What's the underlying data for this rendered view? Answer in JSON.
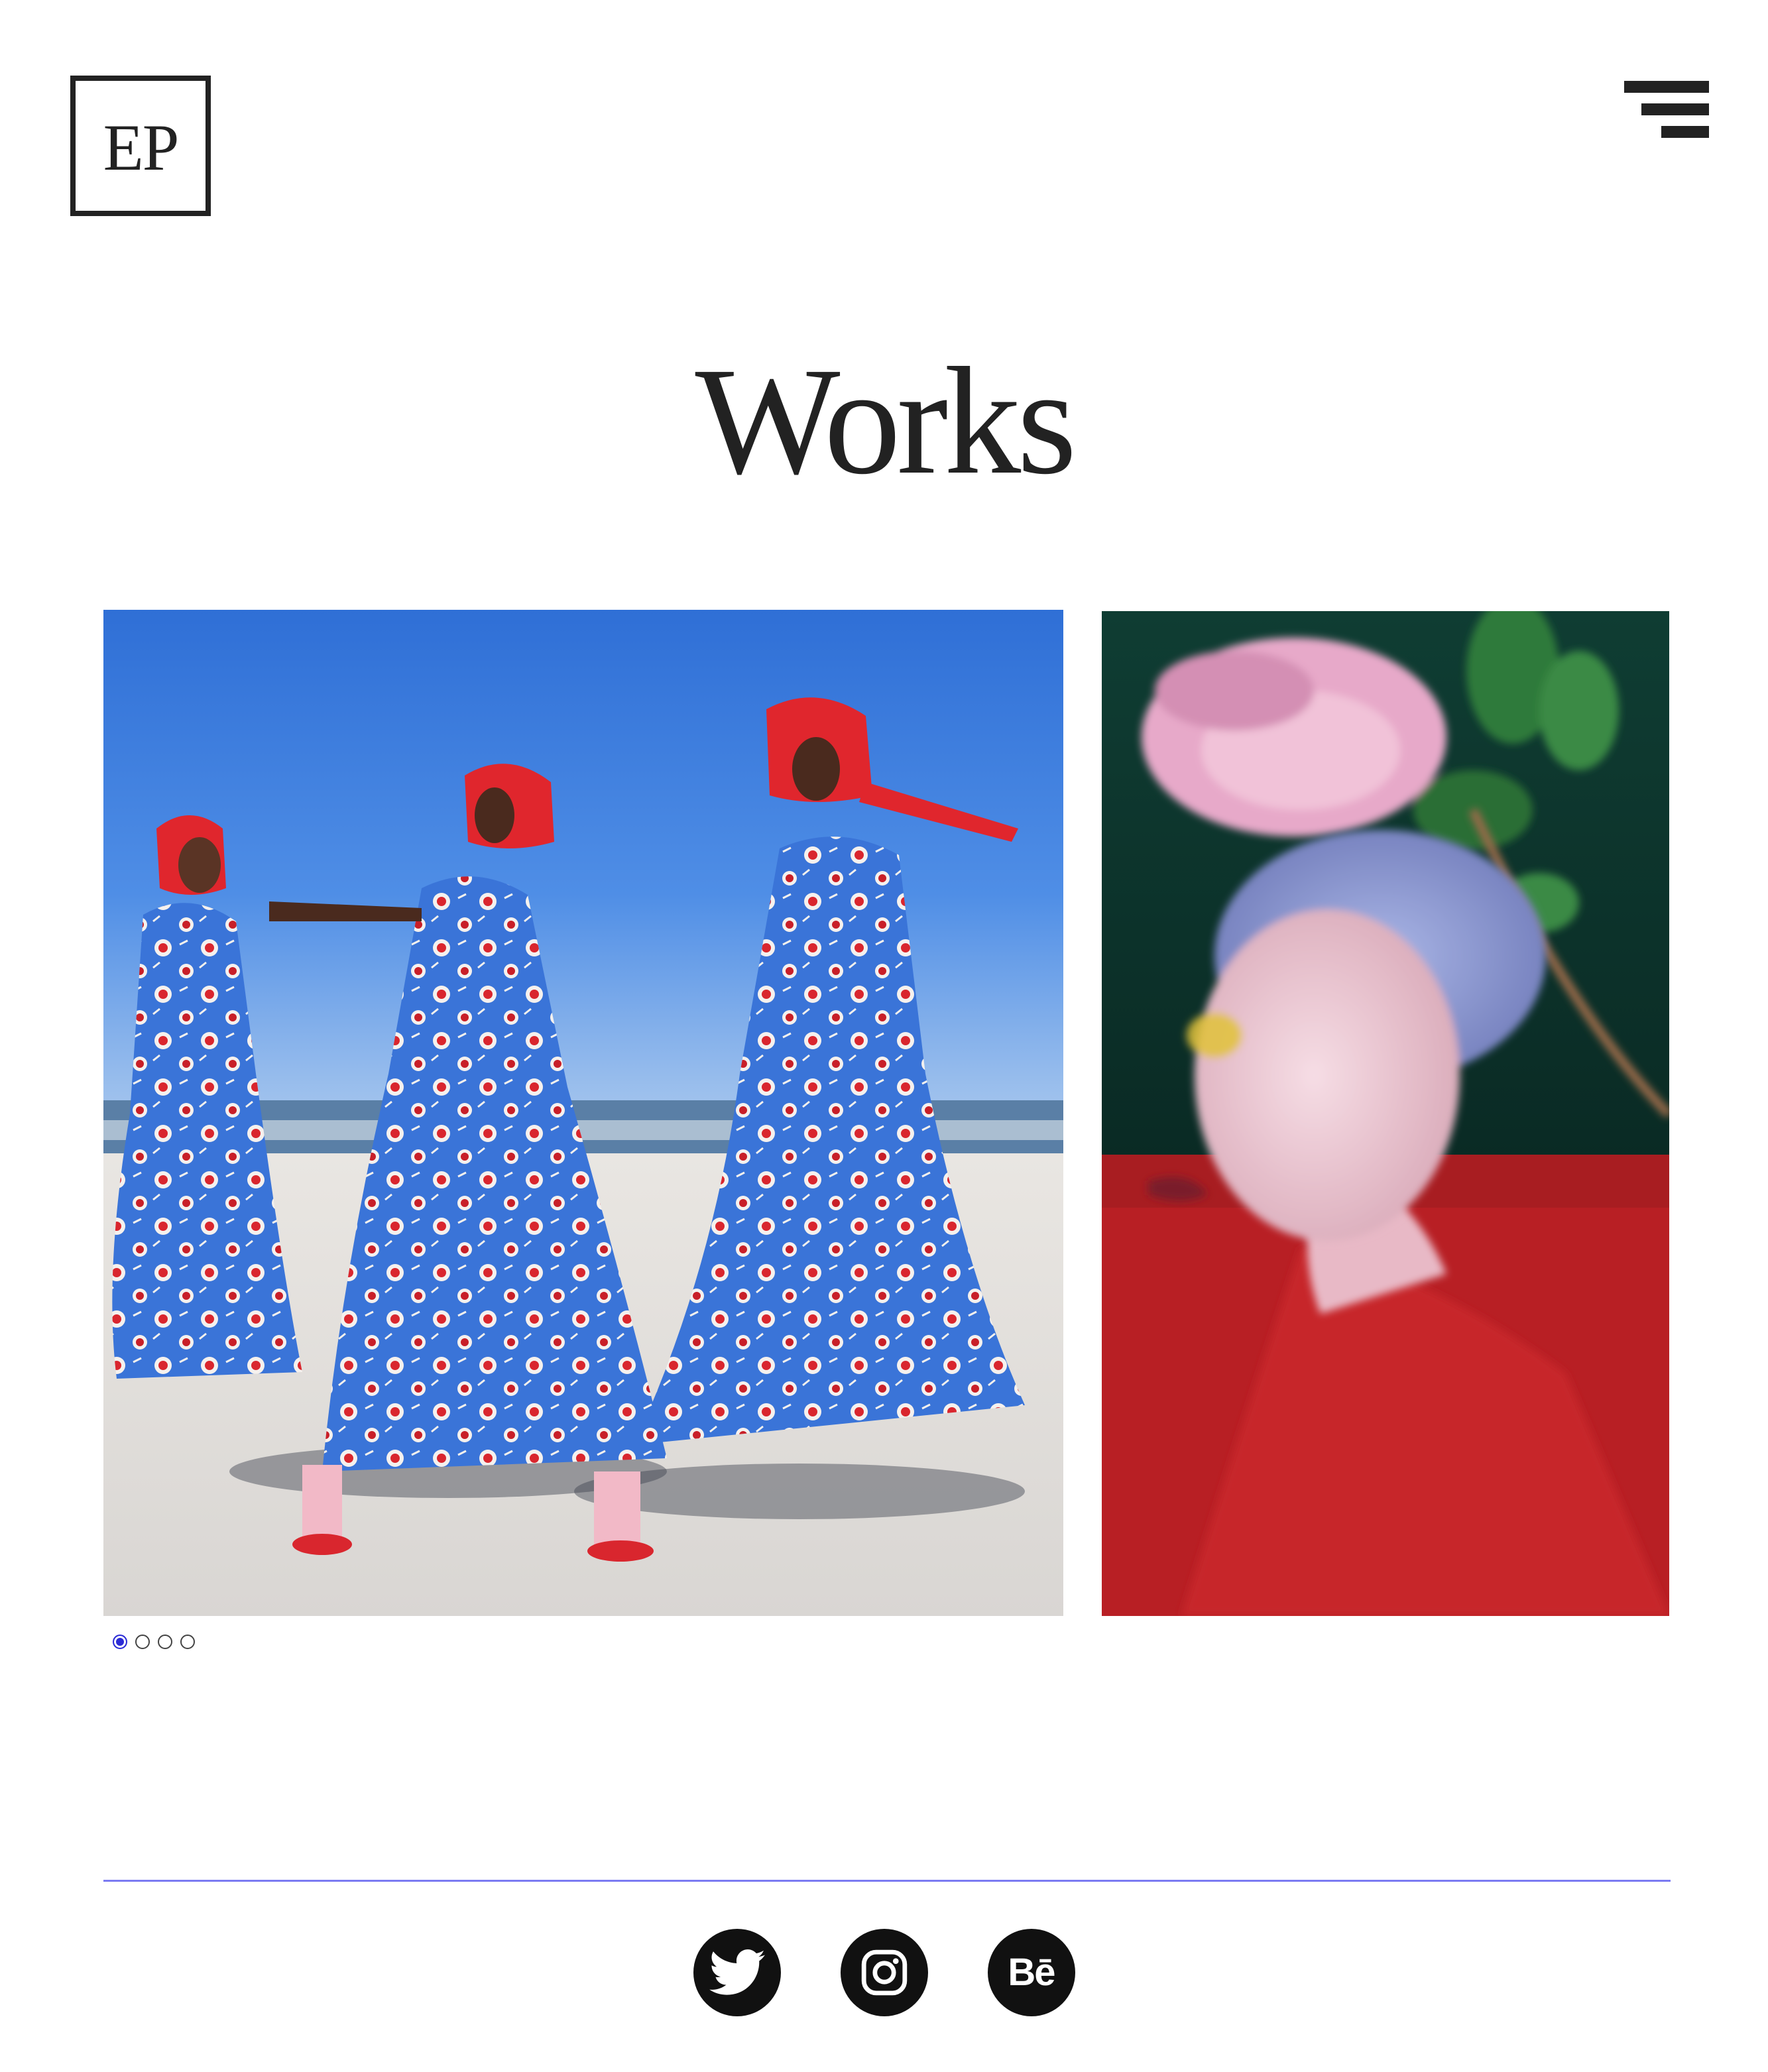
{
  "header": {
    "logo_text": "EP",
    "menu_icon": "menu-icon"
  },
  "main": {
    "title": "Works",
    "works": [
      {
        "icon": "beach-fashion-photo"
      },
      {
        "icon": "flower-portrait-photo"
      }
    ],
    "carousel": {
      "total": 4,
      "active_index": 0
    }
  },
  "footer": {
    "rule_color": "#7b7bf2",
    "social": [
      {
        "icon": "twitter-icon"
      },
      {
        "icon": "instagram-icon"
      },
      {
        "icon": "behance-icon",
        "label": "Bē"
      }
    ]
  },
  "colors": {
    "text": "#222222",
    "accent": "#2b2bd6",
    "background": "#ffffff"
  }
}
